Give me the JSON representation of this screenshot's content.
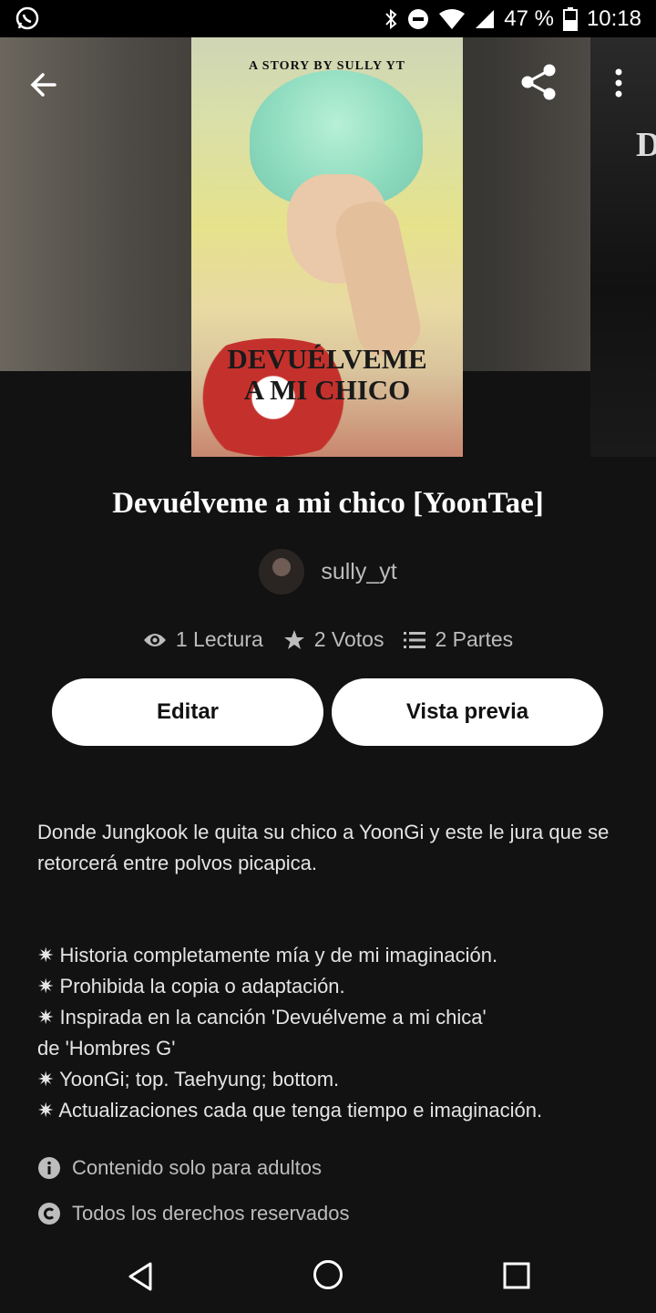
{
  "status_bar": {
    "battery": "47 %",
    "time": "10:18",
    "icons": [
      "whatsapp-icon",
      "bluetooth-icon",
      "do-not-disturb-icon",
      "wifi-icon",
      "signal-icon",
      "battery-icon"
    ]
  },
  "cover": {
    "tagline": "A STORY BY SULLY YT",
    "title_line1": "DEVUÉLVEME",
    "title_line2": "A MI CHICO",
    "next_cover_letter": "D"
  },
  "story": {
    "title": "Devuélveme a mi chico [YoonTae]",
    "author": "sully_yt"
  },
  "stats": {
    "reads": "1 Lectura",
    "votes": "2 Votos",
    "parts": "2 Partes"
  },
  "actions": {
    "edit": "Editar",
    "preview": "Vista previa"
  },
  "description": "Donde Jungkook le quita su chico a YoonGi y este le jura que se retorcerá entre polvos picapica.",
  "bullets": [
    "✷ Historia completamente mía y de mi imaginación.",
    "✷ Prohibida la copia o adaptación.",
    "✷ Inspirada en la canción 'Devuélveme a mi chica'",
    "de 'Hombres G'",
    "✷ YoonGi; top. Taehyung; bottom.",
    "✷ Actualizaciones cada que tenga tiempo e imaginación."
  ],
  "notices": {
    "mature": "Contenido solo para adultos",
    "rights": "Todos los derechos reservados"
  },
  "colors": {
    "background": "#121212",
    "text": "#ffffff",
    "muted": "#bdbdbd",
    "button_bg": "#ffffff"
  }
}
